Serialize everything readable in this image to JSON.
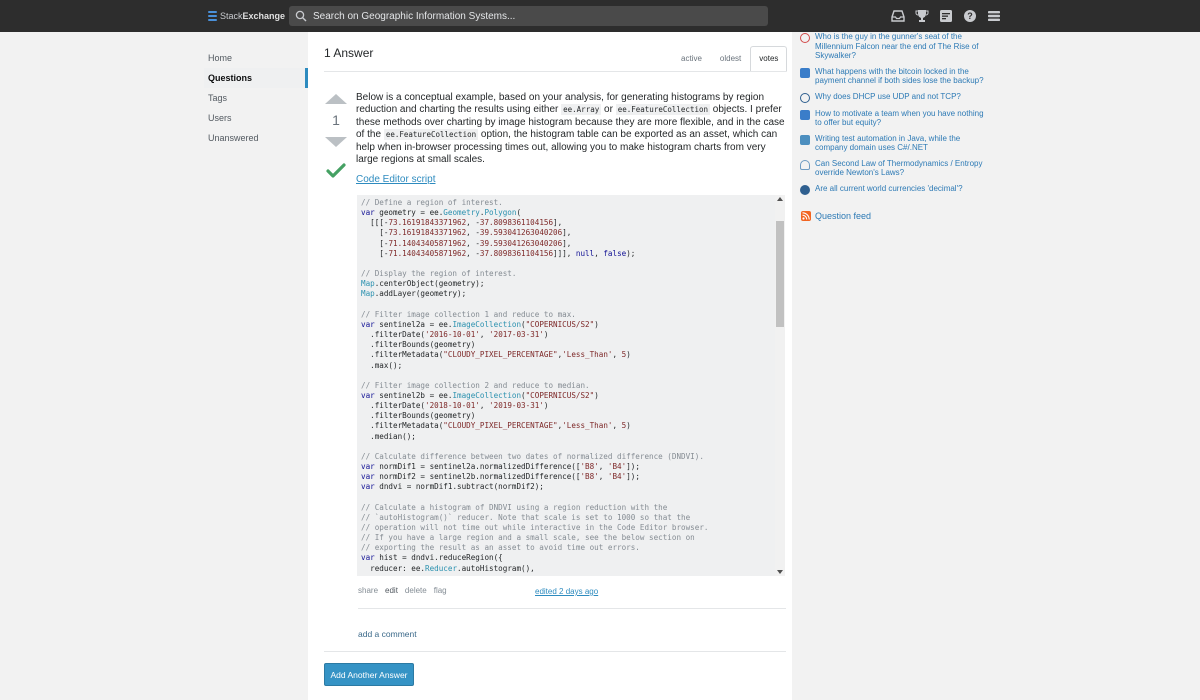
{
  "site": {
    "name_regular": "Stack",
    "name_bold": "Exchange"
  },
  "search": {
    "placeholder": "Search on Geographic Information Systems..."
  },
  "topbar_icons": [
    "inbox-icon",
    "achievements-icon",
    "review-icon",
    "help-icon",
    "site-switcher-icon"
  ],
  "nav": {
    "items": [
      {
        "label": "Home",
        "active": false
      },
      {
        "label": "Questions",
        "active": true
      },
      {
        "label": "Tags",
        "active": false
      },
      {
        "label": "Users",
        "active": false
      },
      {
        "label": "Unanswered",
        "active": false
      }
    ]
  },
  "answers": {
    "count_label": "1 Answer",
    "tabs": [
      {
        "label": "active"
      },
      {
        "label": "oldest"
      },
      {
        "label": "votes",
        "active": true
      }
    ]
  },
  "answer": {
    "vote_count": "1",
    "accepted": true,
    "text": {
      "p1": "Below is a conceptual example, based on your analysis, for generating histograms by region reduction and charting the results using either ",
      "code1": "ee.Array",
      "p2": " or ",
      "code2": "ee.FeatureCollection",
      "p3": " objects. I prefer these methods over charting by image histogram because they are more flexible, and in the case of the ",
      "code3": "ee.FeatureCollection",
      "p4": " option, the histogram table can be exported as an asset, which can help when in-browser processing times out, allowing you to make histogram charts from very large regions at small scales."
    },
    "link_label": "Code Editor script",
    "menu": {
      "share": "share",
      "edit": "edit",
      "delete": "delete",
      "flag": "flag"
    },
    "edited": "edited 2 days ago",
    "add_comment": "add a comment"
  },
  "add_answer_label": "Add Another Answer",
  "hot_network": [
    {
      "title": "Who is the guy in the gunner's seat of the Millennium Falcon near the end of The Rise of Skywalker?",
      "icon_color": "#d24b4b"
    },
    {
      "title": "What happens with the bitcoin locked in the payment channel if both sides lose the backup?",
      "icon_color": "#3a7dc9"
    },
    {
      "title": "Why does DHCP use UDP and not TCP?",
      "icon_color": "#2f5f8f"
    },
    {
      "title": "How to motivate a team when you have nothing to offer but equity?",
      "icon_color": "#3a7dc9"
    },
    {
      "title": "Writing test automation in Java, while the company domain uses C#/.NET",
      "icon_color": "#4d8fbf"
    },
    {
      "title": "Can Second Law of Thermodynamics / Entropy override Newton's Laws?",
      "icon_color": "#6e9bc2"
    },
    {
      "title": "Are all current world currencies 'decimal'?",
      "icon_color": "#2f5f8f"
    }
  ],
  "feed_label": "Question feed"
}
